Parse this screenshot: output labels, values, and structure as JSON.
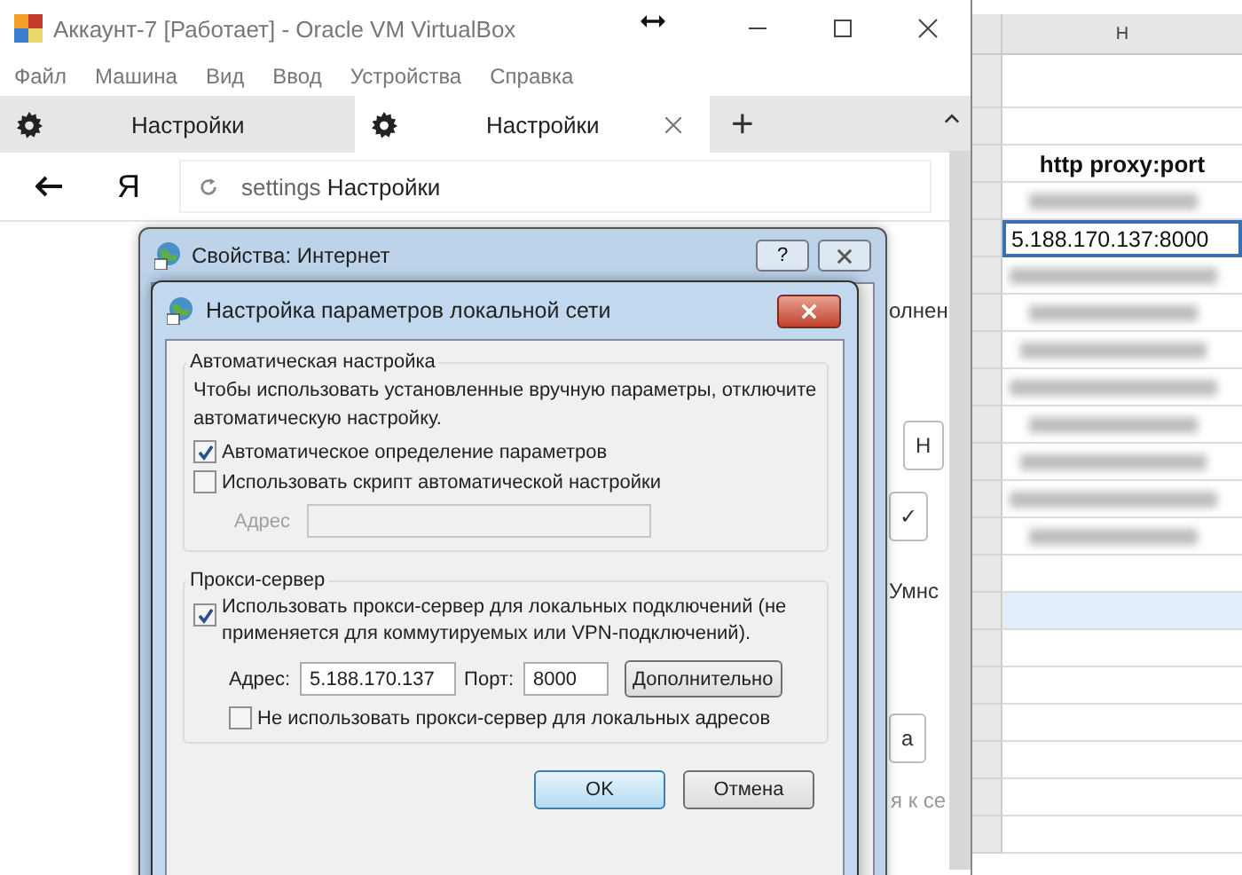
{
  "vbox_window": {
    "title": "Аккаунт-7 [Работает] - Oracle VM VirtualBox",
    "menu": [
      "Файл",
      "Машина",
      "Вид",
      "Ввод",
      "Устройства",
      "Справка"
    ],
    "tabs": [
      {
        "label": "Настройки",
        "selected": false
      },
      {
        "label": "Настройки",
        "selected": true
      }
    ],
    "new_tab": "+",
    "logo": "Я",
    "address_bar": {
      "scheme": "settings",
      "title": "Настройки"
    },
    "background_fragments": [
      {
        "kind": "text",
        "text": "олнен"
      },
      {
        "kind": "button",
        "text": "Н"
      },
      {
        "kind": "check",
        "text": "✓"
      },
      {
        "kind": "text",
        "text": "Умнс"
      },
      {
        "kind": "button",
        "text": "а"
      },
      {
        "kind": "faint",
        "text": "я к се"
      }
    ]
  },
  "spreadsheet": {
    "column_header": "H",
    "rows": [
      {
        "kind": "blank",
        "selected": false,
        "highlighted": false
      },
      {
        "kind": "blank",
        "selected": false,
        "highlighted": false
      },
      {
        "kind": "header",
        "text": "http proxy:port",
        "selected": false,
        "highlighted": false
      },
      {
        "kind": "blurred",
        "selected": false,
        "highlighted": false
      },
      {
        "kind": "value",
        "text": "5.188.170.137:8000",
        "selected": true,
        "highlighted": false
      },
      {
        "kind": "blurred",
        "selected": false,
        "highlighted": false
      },
      {
        "kind": "blurred",
        "selected": false,
        "highlighted": false
      },
      {
        "kind": "blurred",
        "selected": false,
        "highlighted": false
      },
      {
        "kind": "blurred",
        "selected": false,
        "highlighted": false
      },
      {
        "kind": "blurred",
        "selected": false,
        "highlighted": false
      },
      {
        "kind": "blurred",
        "selected": false,
        "highlighted": false
      },
      {
        "kind": "blurred",
        "selected": false,
        "highlighted": false
      },
      {
        "kind": "blurred",
        "selected": false,
        "highlighted": false
      },
      {
        "kind": "blank",
        "selected": false,
        "highlighted": false
      },
      {
        "kind": "blank",
        "selected": false,
        "highlighted": true
      },
      {
        "kind": "blank",
        "selected": false,
        "highlighted": false
      },
      {
        "kind": "blank",
        "selected": false,
        "highlighted": false
      },
      {
        "kind": "blank",
        "selected": false,
        "highlighted": false
      },
      {
        "kind": "blank",
        "selected": false,
        "highlighted": false
      },
      {
        "kind": "blank",
        "selected": false,
        "highlighted": false
      },
      {
        "kind": "blank",
        "selected": false,
        "highlighted": false
      }
    ]
  },
  "internet_properties": {
    "title": "Свойства: Интернет",
    "help_button": "?"
  },
  "lan_dialog": {
    "title": "Настройка параметров локальной сети",
    "auto_group": {
      "legend": "Автоматическая настройка",
      "description": "Чтобы использовать установленные вручную параметры, отключите автоматическую настройку.",
      "options": [
        {
          "label": "Автоматическое определение параметров",
          "checked": true
        },
        {
          "label": "Использовать скрипт автоматической настройки",
          "checked": false
        }
      ],
      "address_label": "Адрес",
      "address_disabled": true
    },
    "proxy_group": {
      "legend": "Прокси-сервер",
      "use_proxy": {
        "label": "Использовать прокси-сервер для локальных подключений (не применяется для коммутируемых или VPN-подключений).",
        "checked": true
      },
      "address_label": "Адрес:",
      "address": "5.188.170.137",
      "port_label": "Порт:",
      "port": "8000",
      "advanced_button": "Дополнительно",
      "bypass": {
        "label": "Не использовать прокси-сервер для локальных адресов",
        "checked": false
      }
    },
    "buttons": [
      {
        "label": "OK",
        "default": true
      },
      {
        "label": "Отмена",
        "default": false
      }
    ]
  }
}
